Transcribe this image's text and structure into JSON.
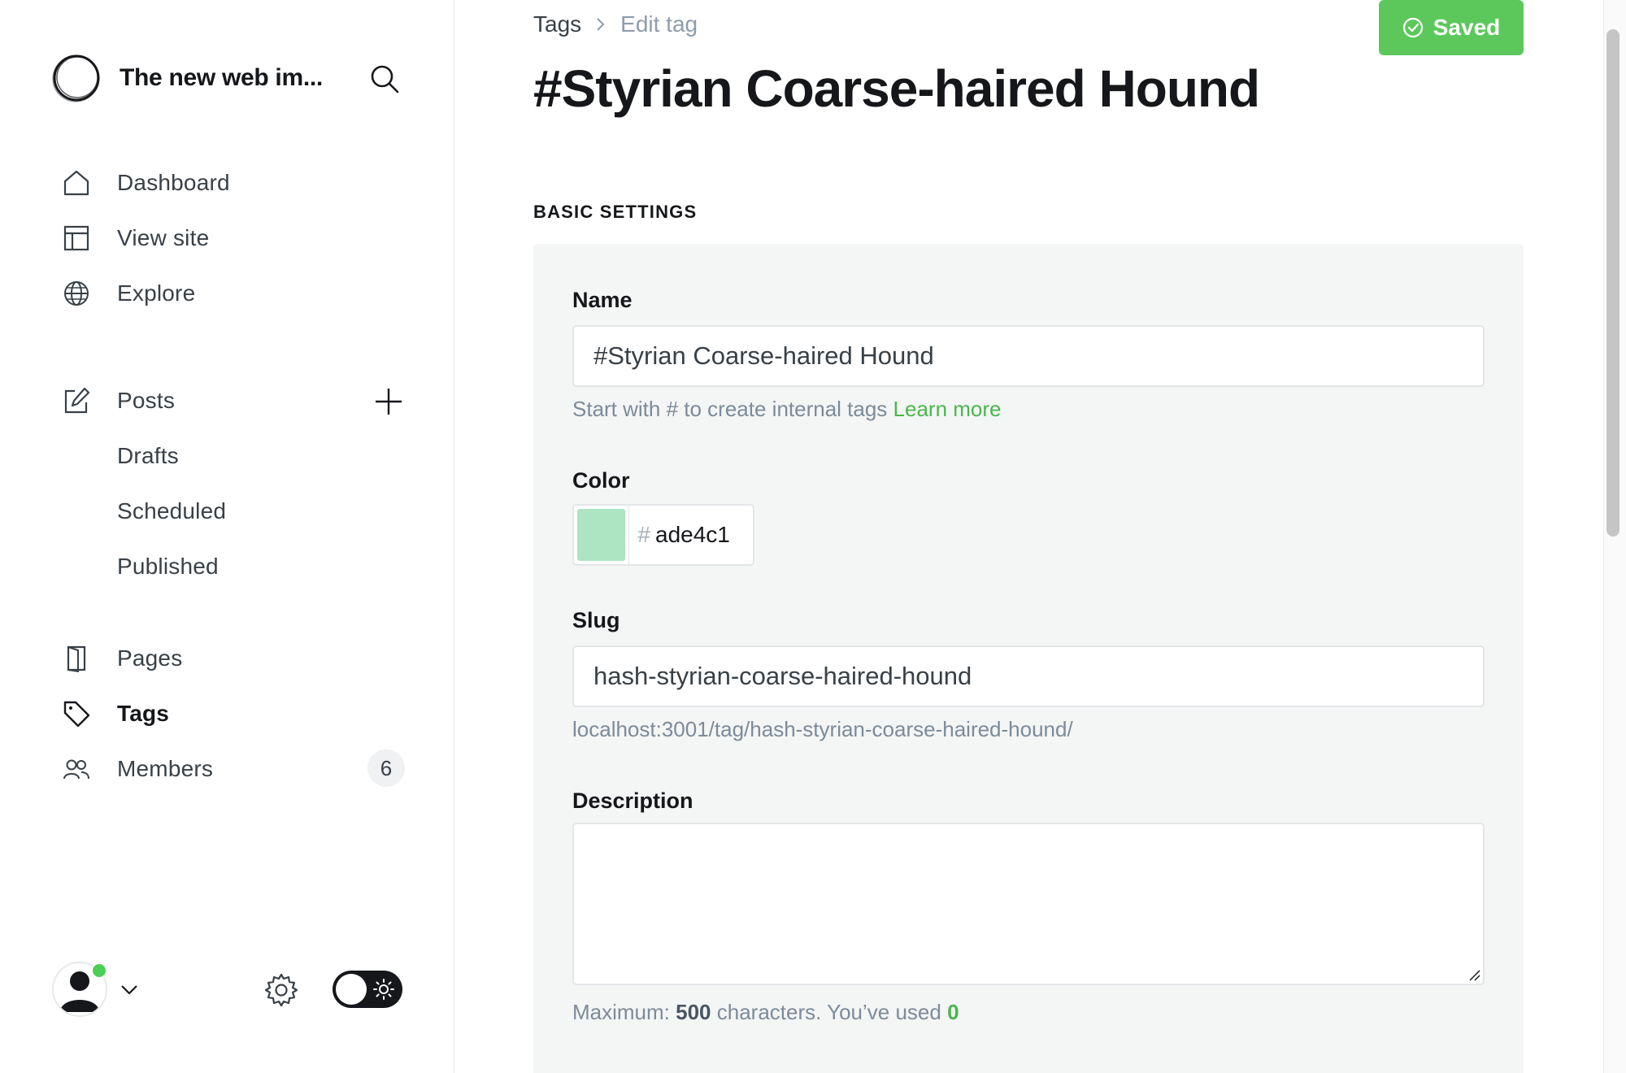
{
  "site": {
    "title": "The new web im..."
  },
  "nav": {
    "dashboard": "Dashboard",
    "view_site": "View site",
    "explore": "Explore",
    "posts": "Posts",
    "drafts": "Drafts",
    "scheduled": "Scheduled",
    "published": "Published",
    "pages": "Pages",
    "tags": "Tags",
    "members": "Members",
    "members_count": "6"
  },
  "breadcrumb": {
    "parent": "Tags",
    "current": "Edit tag"
  },
  "save_button": {
    "label": "Saved"
  },
  "page": {
    "title": "#Styrian Coarse-haired Hound"
  },
  "section": {
    "title": "BASIC SETTINGS"
  },
  "form": {
    "name": {
      "label": "Name",
      "value": "#Styrian Coarse-haired Hound",
      "hint": "Start with # to create internal tags",
      "hint_link": "Learn more"
    },
    "color": {
      "label": "Color",
      "hash": "#",
      "value": "ade4c1",
      "swatch": "#ade4c1"
    },
    "slug": {
      "label": "Slug",
      "value": "hash-styrian-coarse-haired-hound",
      "url": "localhost:3001/tag/hash-styrian-coarse-haired-hound/"
    },
    "description": {
      "label": "Description",
      "value": "",
      "hint_prefix": "Maximum:",
      "max": "500",
      "hint_mid": "characters. You’ve used",
      "used": "0"
    }
  },
  "colors": {
    "accent": "#5cc85c",
    "link": "#4bb74b",
    "online": "#4ccf57"
  }
}
